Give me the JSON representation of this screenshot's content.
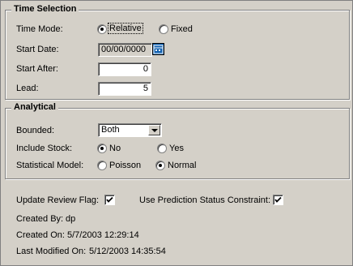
{
  "time_selection": {
    "title": "Time Selection",
    "time_mode_label": "Time Mode:",
    "relative_label": "Relative",
    "fixed_label": "Fixed",
    "start_date_label": "Start Date:",
    "start_date_value": "00/00/0000",
    "calendar_icon_text": "CAL",
    "start_after_label": "Start After:",
    "start_after_value": "0",
    "lead_label": "Lead:",
    "lead_value": "5"
  },
  "analytical": {
    "title": "Analytical",
    "bounded_label": "Bounded:",
    "bounded_value": "Both",
    "include_stock_label": "Include Stock:",
    "no_label": "No",
    "yes_label": "Yes",
    "statistical_model_label": "Statistical Model:",
    "poisson_label": "Poisson",
    "normal_label": "Normal"
  },
  "footer": {
    "update_review_flag_label": "Update Review Flag:",
    "use_prediction_label": "Use Prediction Status Constraint:",
    "created_by_label": "Created By:",
    "created_by_value": "dp",
    "created_on_label": "Created On:",
    "created_on_value": "5/7/2003 12:29:14",
    "last_modified_label": "Last Modified On:",
    "last_modified_value": "5/12/2003 14:35:54"
  }
}
